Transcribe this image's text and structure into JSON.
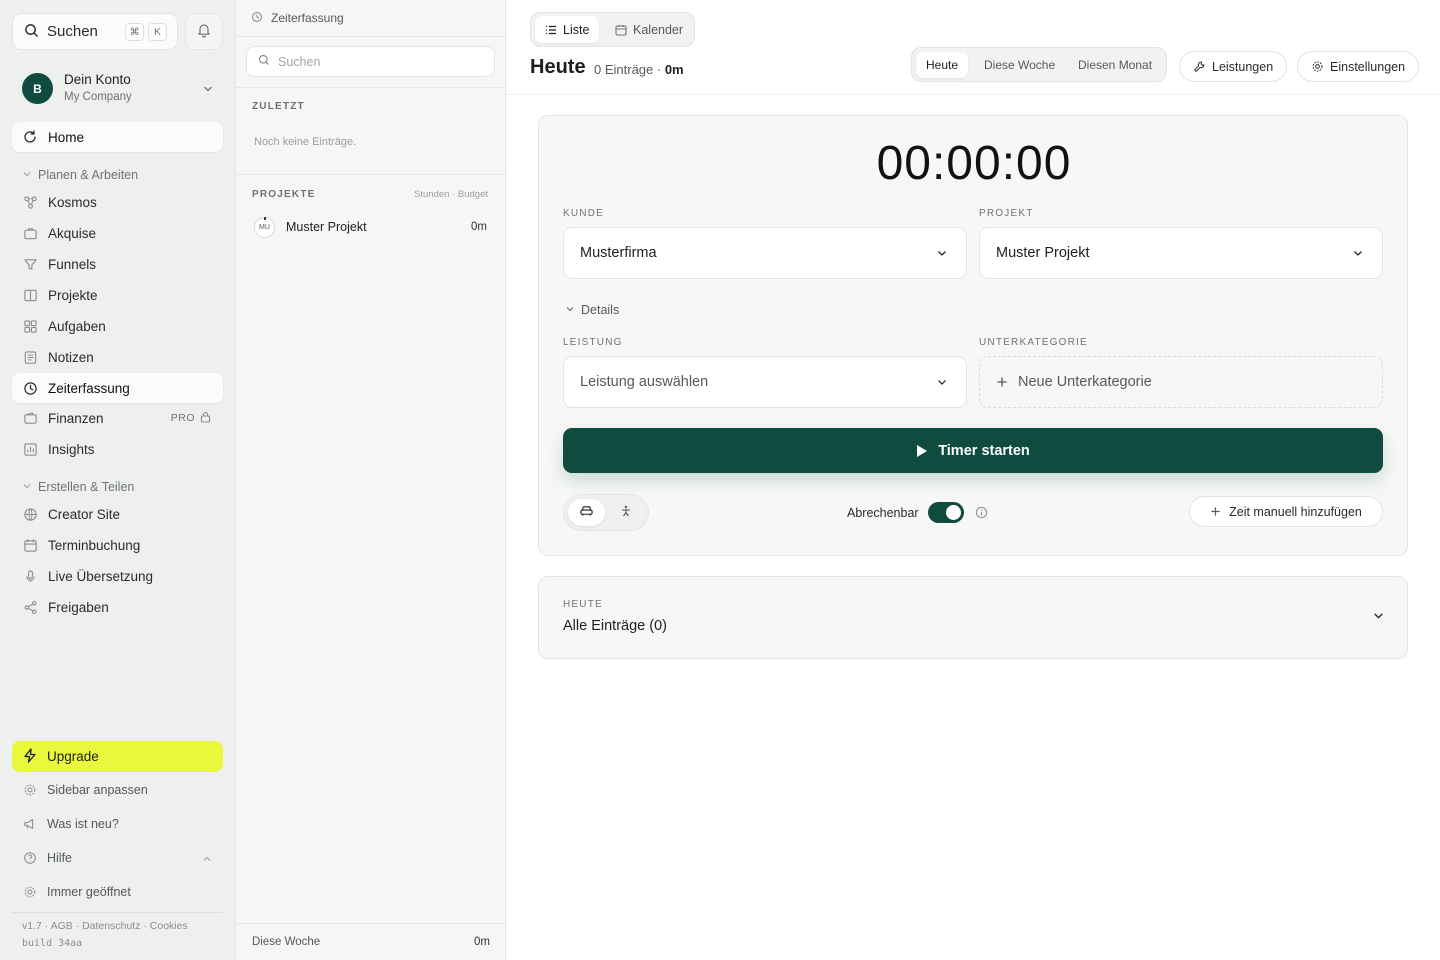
{
  "sidebar": {
    "search_label": "Suchen",
    "shortcut_keys": [
      "⌘",
      "K"
    ],
    "account": {
      "avatar_letter": "B",
      "name": "Dein Konto",
      "company": "My Company"
    },
    "home_label": "Home",
    "group_plan_label": "Planen & Arbeiten",
    "items_plan": [
      {
        "label": "Kosmos",
        "icon": "network-icon"
      },
      {
        "label": "Akquise",
        "icon": "briefcase-icon"
      },
      {
        "label": "Funnels",
        "icon": "funnel-icon"
      },
      {
        "label": "Projekte",
        "icon": "columns-icon"
      },
      {
        "label": "Aufgaben",
        "icon": "grid-icon"
      },
      {
        "label": "Notizen",
        "icon": "note-icon"
      },
      {
        "label": "Zeiterfassung",
        "icon": "clock-icon"
      },
      {
        "label": "Finanzen",
        "icon": "wallet-icon",
        "badge": "PRO"
      },
      {
        "label": "Insights",
        "icon": "chart-icon"
      }
    ],
    "group_create_label": "Erstellen & Teilen",
    "items_create": [
      {
        "label": "Creator Site",
        "icon": "globe-icon"
      },
      {
        "label": "Terminbuchung",
        "icon": "calendar-icon"
      },
      {
        "label": "Live Übersetzung",
        "icon": "microphone-icon"
      },
      {
        "label": "Freigaben",
        "icon": "share-icon"
      }
    ],
    "upgrade_label": "Upgrade",
    "footer_items": [
      {
        "label": "Sidebar anpassen",
        "icon": "gear-icon"
      },
      {
        "label": "Was ist neu?",
        "icon": "megaphone-icon"
      },
      {
        "label": "Hilfe",
        "icon": "help-icon"
      },
      {
        "label": "Immer geöffnet",
        "icon": "gear-icon"
      }
    ],
    "version_line": "v1.7 · AGB · Datenschutz · Cookies",
    "build_line": "build 34aa"
  },
  "mid": {
    "header_title": "Zeiterfassung",
    "search_placeholder": "Suchen",
    "recent_label": "ZULETZT",
    "recent_empty": "Noch keine Einträge.",
    "projects_label": "PROJEKTE",
    "projects_meta": "Stunden · Budget",
    "projects": [
      {
        "initials": "MU",
        "name": "Muster Projekt",
        "value": "0m"
      }
    ],
    "footer_label": "Diese Woche",
    "footer_value": "0m"
  },
  "main": {
    "view_tabs": [
      {
        "label": "Liste",
        "active": true
      },
      {
        "label": "Kalender",
        "active": false
      }
    ],
    "title": "Heute",
    "entries_count": "0 Einträge",
    "sep": " · ",
    "total": "0m",
    "range_tabs": [
      {
        "label": "Heute",
        "active": true
      },
      {
        "label": "Diese Woche",
        "active": false
      },
      {
        "label": "Diesen Monat",
        "active": false
      }
    ],
    "services_button": "Leistungen",
    "settings_button": "Einstellungen",
    "timer": {
      "display": "00:00:00",
      "client_label": "KUNDE",
      "client_value": "Musterfirma",
      "project_label": "PROJEKT",
      "project_value": "Muster Projekt",
      "details_label": "Details",
      "service_label": "LEISTUNG",
      "service_placeholder": "Leistung auswählen",
      "subcategory_label": "UNTERKATEGORIE",
      "subcategory_add": "Neue Unterkategorie",
      "start_button": "Timer starten",
      "billable_label": "Abrechenbar",
      "billable_on": true,
      "manual_button": "Zeit manuell hinzufügen"
    },
    "entries": {
      "label": "HEUTE",
      "title": "Alle Einträge (0)"
    }
  },
  "colors": {
    "brand": "#0f4b3e",
    "upgrade": "#e9f73d",
    "sidebar_bg": "#eef0ed"
  }
}
